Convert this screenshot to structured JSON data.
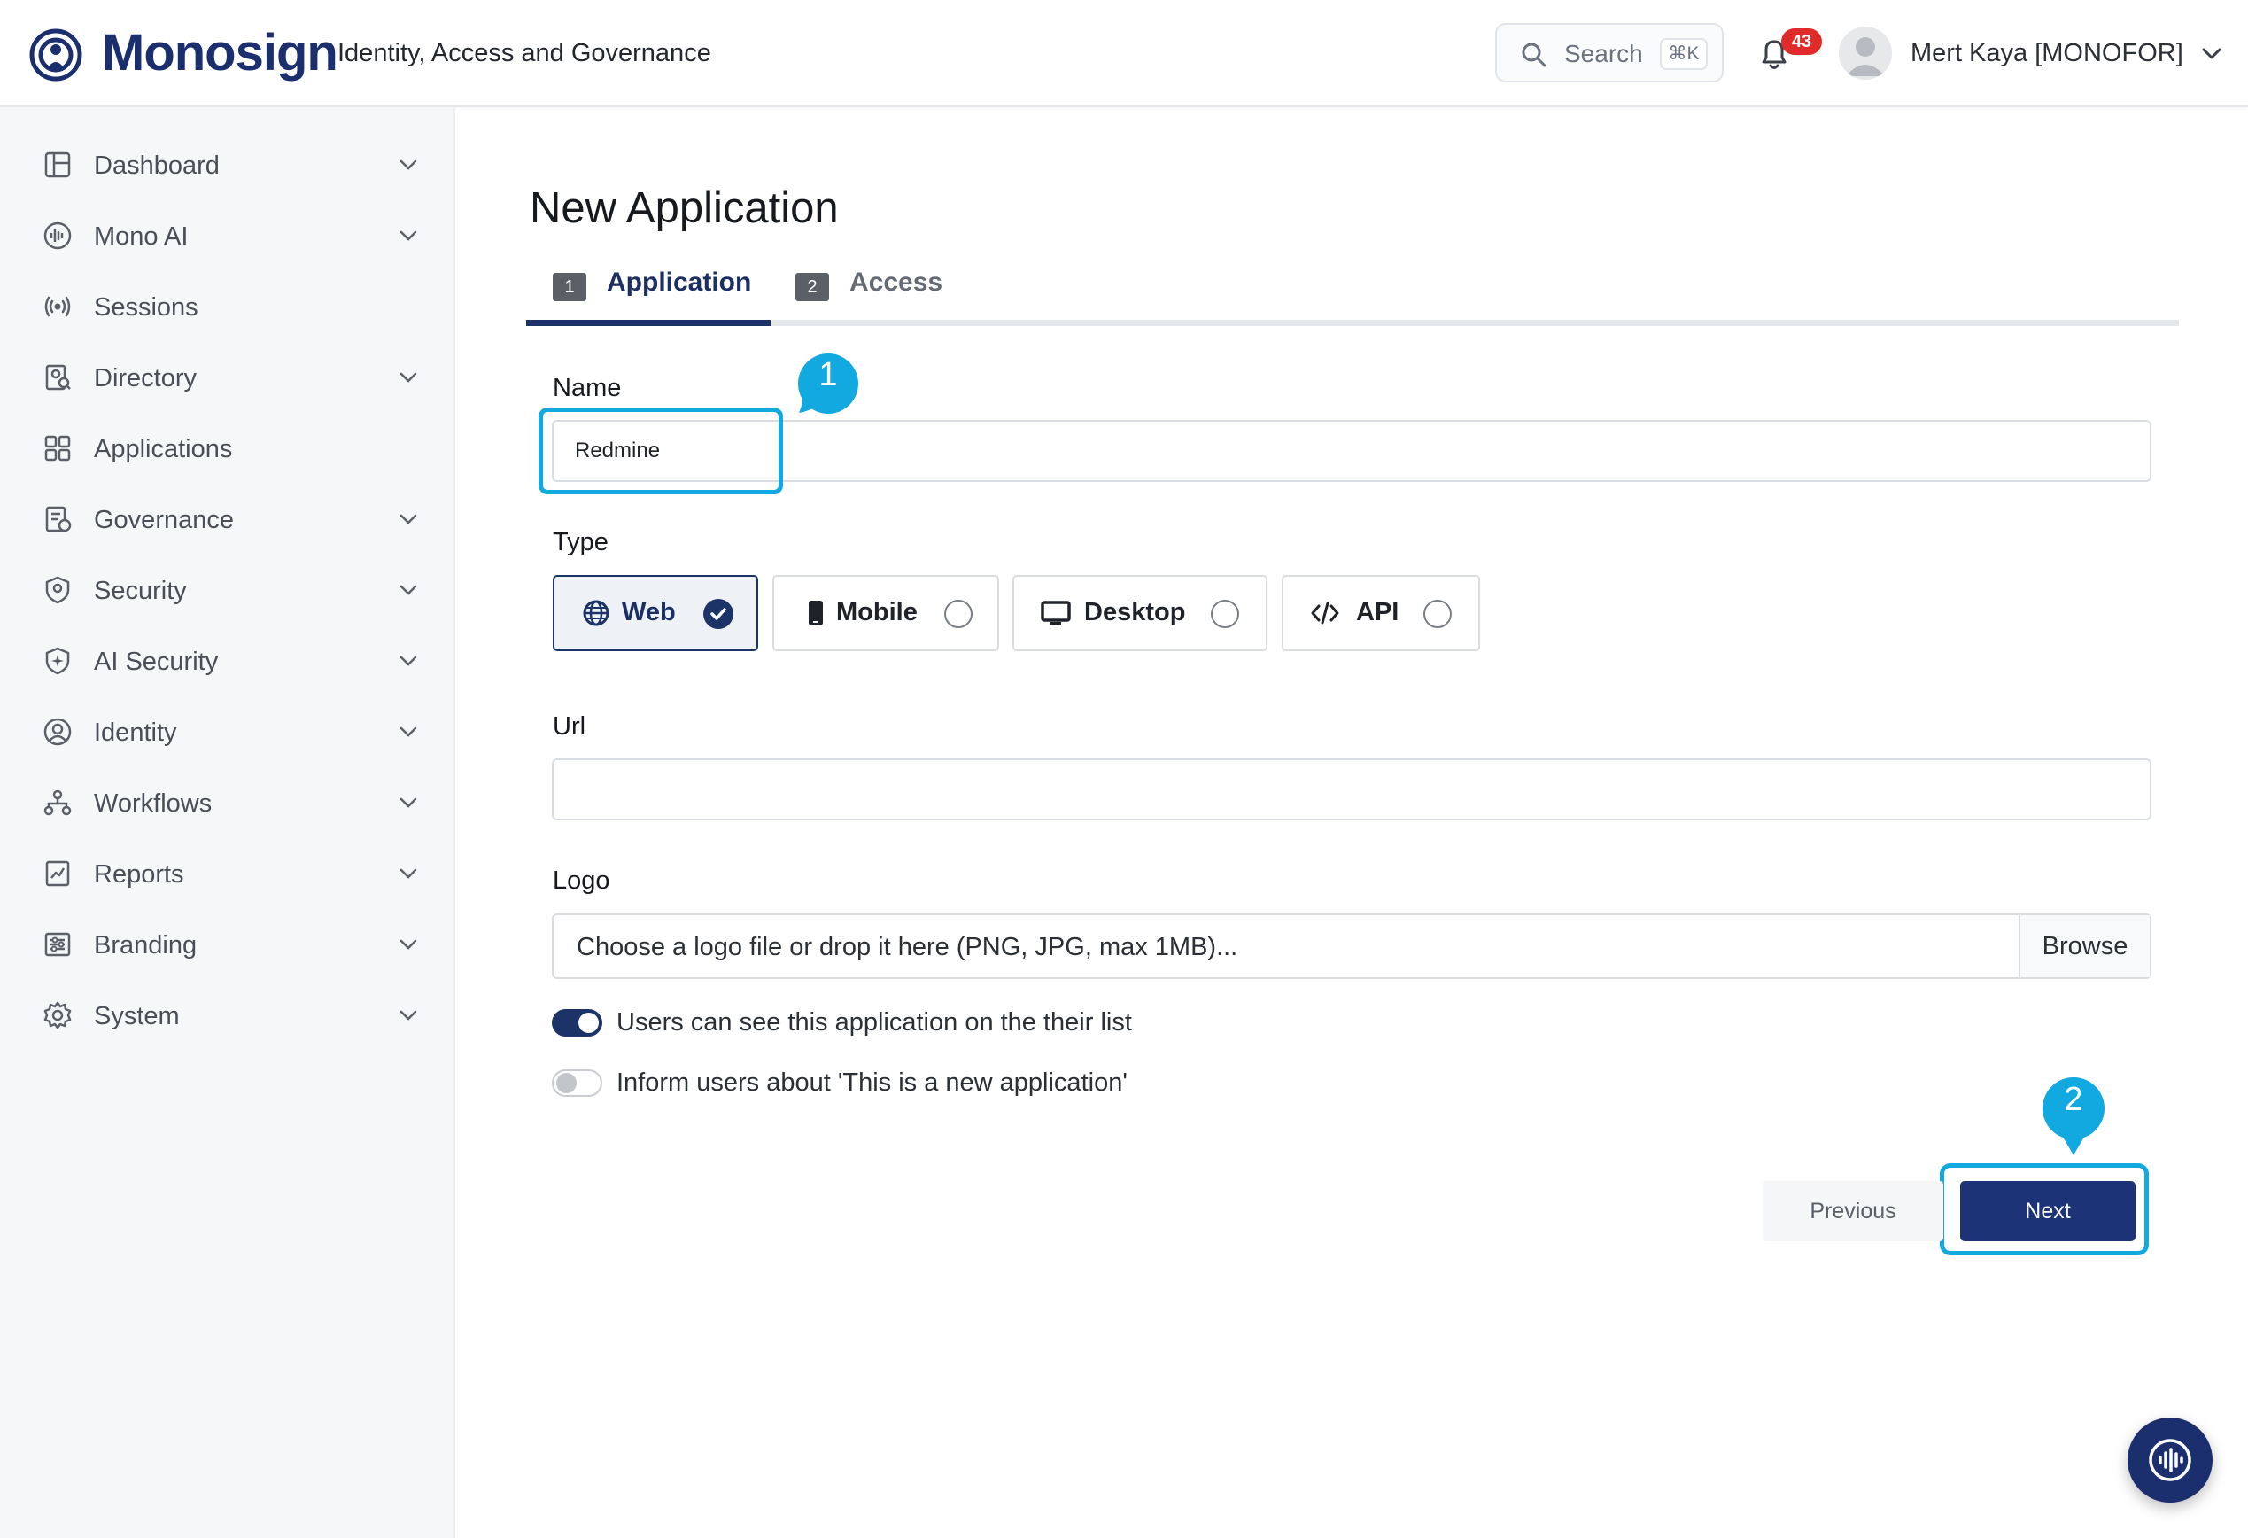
{
  "header": {
    "brand": "Monosign",
    "tagline": "Identity, Access and Governance",
    "search": {
      "label": "Search",
      "shortcut": "⌘K"
    },
    "notifications_count": "43",
    "user": {
      "name": "Mert Kaya [MONOFOR]"
    }
  },
  "sidebar": {
    "items": [
      {
        "label": "Dashboard",
        "icon": "dashboard-icon",
        "expandable": true
      },
      {
        "label": "Mono AI",
        "icon": "mono-ai-icon",
        "expandable": true
      },
      {
        "label": "Sessions",
        "icon": "sessions-icon",
        "expandable": false
      },
      {
        "label": "Directory",
        "icon": "directory-icon",
        "expandable": true
      },
      {
        "label": "Applications",
        "icon": "applications-icon",
        "expandable": false
      },
      {
        "label": "Governance",
        "icon": "governance-icon",
        "expandable": true
      },
      {
        "label": "Security",
        "icon": "security-icon",
        "expandable": true
      },
      {
        "label": "AI Security",
        "icon": "ai-security-icon",
        "expandable": true
      },
      {
        "label": "Identity",
        "icon": "identity-icon",
        "expandable": true
      },
      {
        "label": "Workflows",
        "icon": "workflows-icon",
        "expandable": true
      },
      {
        "label": "Reports",
        "icon": "reports-icon",
        "expandable": true
      },
      {
        "label": "Branding",
        "icon": "branding-icon",
        "expandable": true
      },
      {
        "label": "System",
        "icon": "system-icon",
        "expandable": true
      }
    ]
  },
  "main": {
    "title": "New Application",
    "tabs": [
      {
        "number": "1",
        "label": "Application",
        "active": true
      },
      {
        "number": "2",
        "label": "Access",
        "active": false
      }
    ],
    "form": {
      "name": {
        "label": "Name",
        "value": "Redmine"
      },
      "type": {
        "label": "Type",
        "options": [
          {
            "label": "Web",
            "icon": "globe-icon",
            "selected": true
          },
          {
            "label": "Mobile",
            "icon": "mobile-icon",
            "selected": false
          },
          {
            "label": "Desktop",
            "icon": "desktop-icon",
            "selected": false
          },
          {
            "label": "API",
            "icon": "code-icon",
            "selected": false
          }
        ]
      },
      "url": {
        "label": "Url",
        "value": ""
      },
      "logo": {
        "label": "Logo",
        "placeholder": "Choose a logo file or drop it here (PNG, JPG, max 1MB)...",
        "browse_label": "Browse"
      },
      "toggles": [
        {
          "label": "Users can see this application on the their list",
          "on": true
        },
        {
          "label": "Inform users about 'This is a new application'",
          "on": false
        }
      ]
    },
    "buttons": {
      "previous": "Previous",
      "next": "Next"
    },
    "callouts": [
      "1",
      "2"
    ]
  },
  "colors": {
    "brand_navy": "#1b2e6e",
    "primary_button": "#1c3477",
    "highlight": "#12a8e0",
    "badge_red": "#e02b2b",
    "sidebar_bg": "#f6f7f9"
  }
}
